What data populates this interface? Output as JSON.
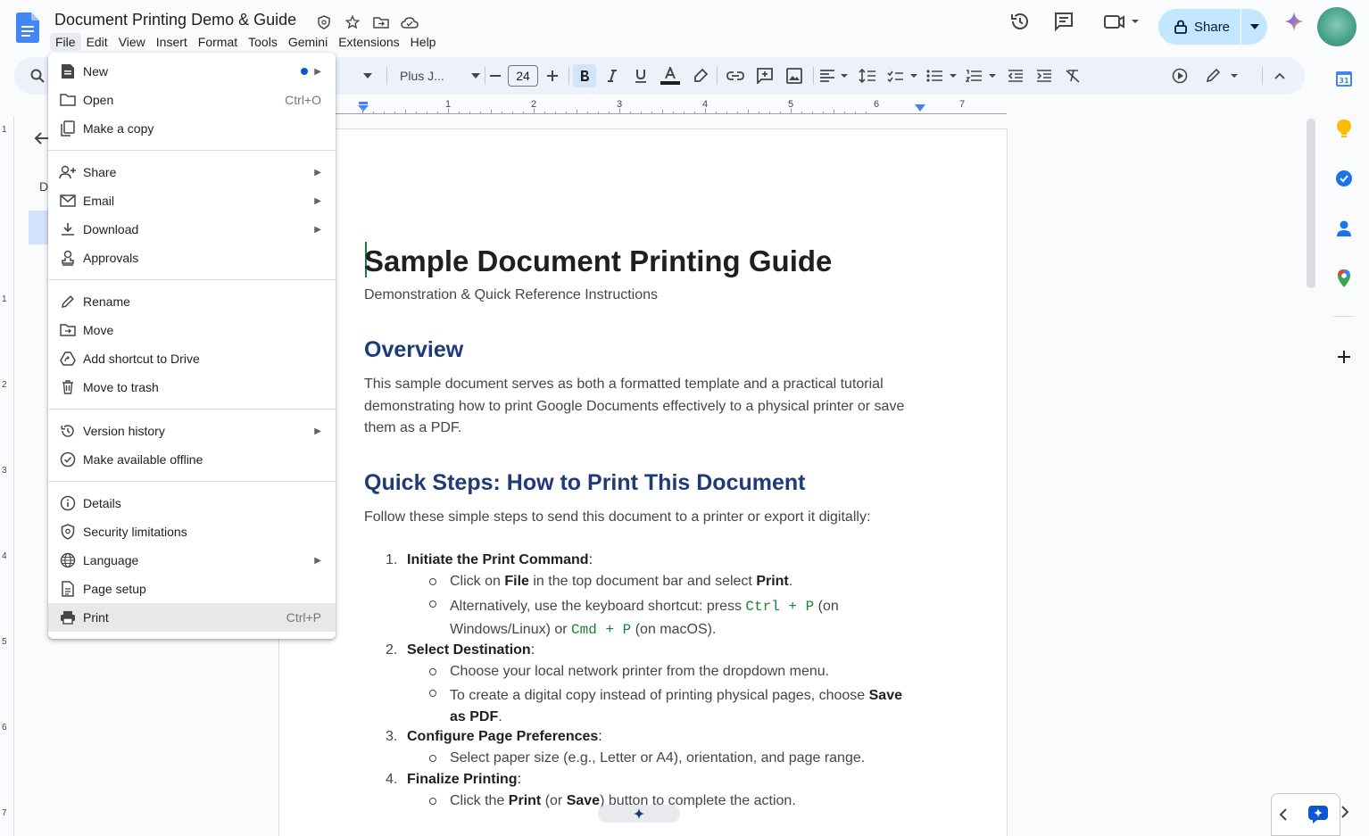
{
  "window": {
    "doc_title": "Document Printing Demo & Guide"
  },
  "menubar": [
    "File",
    "Edit",
    "View",
    "Insert",
    "Format",
    "Tools",
    "Gemini",
    "Extensions",
    "Help"
  ],
  "header": {
    "share_label": "Share"
  },
  "toolbar": {
    "font_name": "Plus J...",
    "font_size": "24"
  },
  "ruler": [
    "1",
    "2",
    "3",
    "4",
    "5",
    "6",
    "7"
  ],
  "vruler": [
    "1",
    "1",
    "2",
    "3",
    "4",
    "5",
    "6",
    "7"
  ],
  "outline": {
    "letter": "D"
  },
  "file_menu": {
    "items": [
      {
        "label": "New",
        "icon": "docs-icon",
        "dot": true,
        "submenu": true
      },
      {
        "label": "Open",
        "icon": "folder-icon",
        "shortcut": "Ctrl+O"
      },
      {
        "label": "Make a copy",
        "icon": "copy-icon"
      },
      {
        "label": "Share",
        "icon": "person-add-icon",
        "submenu": true
      },
      {
        "label": "Email",
        "icon": "mail-icon",
        "submenu": true
      },
      {
        "label": "Download",
        "icon": "download-icon",
        "submenu": true
      },
      {
        "label": "Approvals",
        "icon": "approval-icon"
      },
      {
        "label": "Rename",
        "icon": "pencil-icon"
      },
      {
        "label": "Move",
        "icon": "folder-move-icon"
      },
      {
        "label": "Add shortcut to Drive",
        "icon": "drive-shortcut-icon"
      },
      {
        "label": "Move to trash",
        "icon": "trash-icon"
      },
      {
        "label": "Version history",
        "icon": "history-icon",
        "submenu": true
      },
      {
        "label": "Make available offline",
        "icon": "offline-icon"
      },
      {
        "label": "Details",
        "icon": "info-icon"
      },
      {
        "label": "Security limitations",
        "icon": "shield-icon"
      },
      {
        "label": "Language",
        "icon": "globe-icon",
        "submenu": true
      },
      {
        "label": "Page setup",
        "icon": "page-icon"
      },
      {
        "label": "Print",
        "icon": "printer-icon",
        "shortcut": "Ctrl+P",
        "highlighted": true
      }
    ]
  },
  "document": {
    "title": "Sample Document Printing Guide",
    "subtitle": "Demonstration & Quick Reference Instructions",
    "overview_heading": "Overview",
    "overview_text": "This sample document serves as both a formatted template and a practical tutorial demonstrating how to print Google Documents effectively to a physical printer or save them as a PDF.",
    "steps_heading": "Quick Steps: How to Print This Document",
    "steps_intro": "Follow these simple steps to send this document to a printer or export it digitally:",
    "steps": [
      {
        "num": "1.",
        "title": "Initiate the Print Command",
        "suffix": ":"
      },
      {
        "num": "2.",
        "title": "Select Destination",
        "suffix": ":"
      },
      {
        "num": "3.",
        "title": "Configure Page Preferences",
        "suffix": ":"
      },
      {
        "num": "4.",
        "title": "Finalize Printing",
        "suffix": ":"
      }
    ],
    "s1a": {
      "pre": "Click on ",
      "b1": "File",
      "mid": " in the top document bar and select ",
      "b2": "Print",
      "post": "."
    },
    "s1b": {
      "pre": "Alternatively, use the keyboard shortcut: press ",
      "code1": "Ctrl + P",
      "mid": " (on Windows/Linux) or ",
      "code2": "Cmd + P",
      "post": " (on macOS)."
    },
    "s2a": "Choose your local network printer from the dropdown menu.",
    "s2b": {
      "pre": "To create a digital copy instead of printing physical pages, choose ",
      "b1": "Save as PDF",
      "post": "."
    },
    "s3a": "Select paper size (e.g., Letter or A4), orientation, and page range.",
    "s4a": {
      "pre": "Click the ",
      "b1": "Print",
      "mid": " (or ",
      "b2": "Save",
      "post": ") button to complete the action."
    }
  },
  "colors": {
    "accent": "#0b57d0",
    "heading": "#1e3a78",
    "share_bg": "#c2e7ff"
  }
}
